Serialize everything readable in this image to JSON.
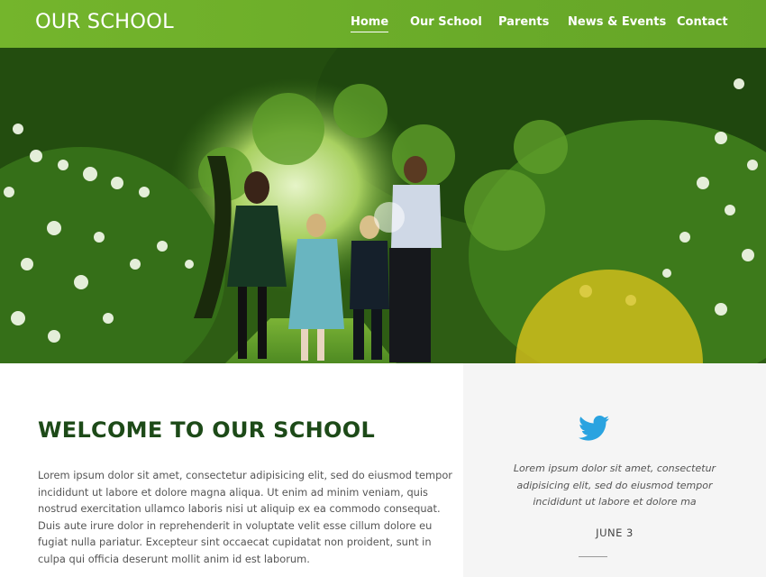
{
  "header": {
    "logo": "OUR SCHOOL",
    "nav": [
      {
        "label": "Home",
        "active": true
      },
      {
        "label": "Our School",
        "active": false
      },
      {
        "label": "Parents",
        "active": false
      },
      {
        "label": "News & Events",
        "active": false
      },
      {
        "label": "Contact",
        "active": false
      }
    ],
    "background_color": "#6cad2a"
  },
  "hero": {
    "image": "children walking down a green wooded path"
  },
  "welcome": {
    "title": "WELCOME TO OUR SCHOOL",
    "body_lines": [
      "Lorem ipsum dolor sit amet, consectetur adipisicing elit, sed do eiusmod tempor",
      "incididunt ut labore et dolore magna aliqua. Ut enim ad minim veniam, quis",
      "nostrud exercitation ullamco laboris nisi ut aliquip ex ea commodo consequat.",
      "Duis aute irure dolor in reprehenderit in voluptate velit esse cillum dolore eu",
      "fugiat nulla pariatur. Excepteur sint occaecat cupidatat non proident, sunt in",
      "culpa qui officia deserunt mollit anim id est laborum."
    ],
    "title_color": "#1d4a18"
  },
  "tweet": {
    "icon": "twitter-bird-icon",
    "icon_color": "#2aa3e0",
    "text_lines": [
      "Lorem ipsum dolor sit amet, consectetur",
      "adipisicing elit, sed do eiusmod tempor",
      "incididunt ut labore et dolore ma"
    ],
    "date": "JUNE 3"
  }
}
